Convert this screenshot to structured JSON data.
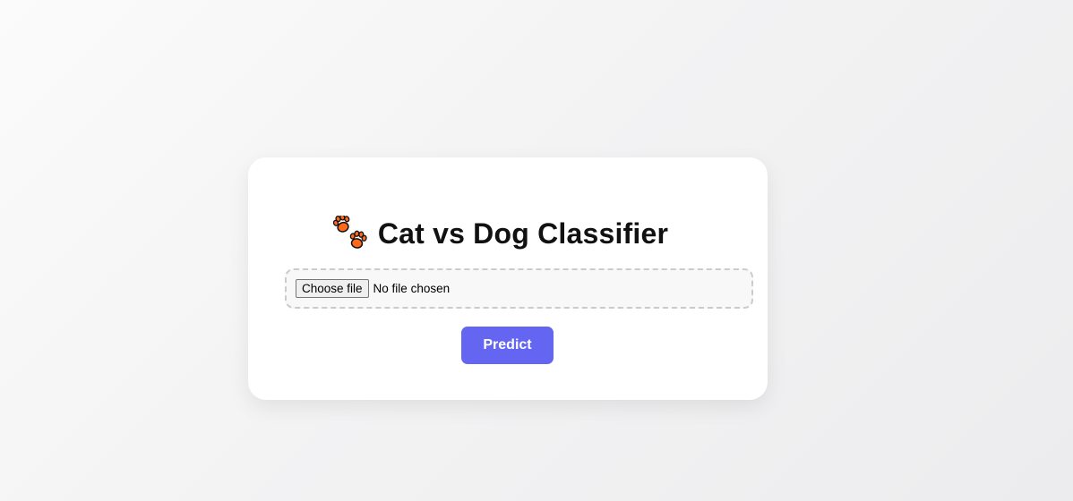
{
  "card": {
    "title": "Cat vs Dog Classifier",
    "title_icon": "paw-prints-icon"
  },
  "upload": {
    "choose_label": "Choose file",
    "status": "No file chosen"
  },
  "actions": {
    "predict_label": "Predict"
  },
  "colors": {
    "accent": "#6466f1",
    "paw": "#ff6a1a",
    "card_bg": "#ffffff",
    "page_bg": "#f3f3f4"
  }
}
